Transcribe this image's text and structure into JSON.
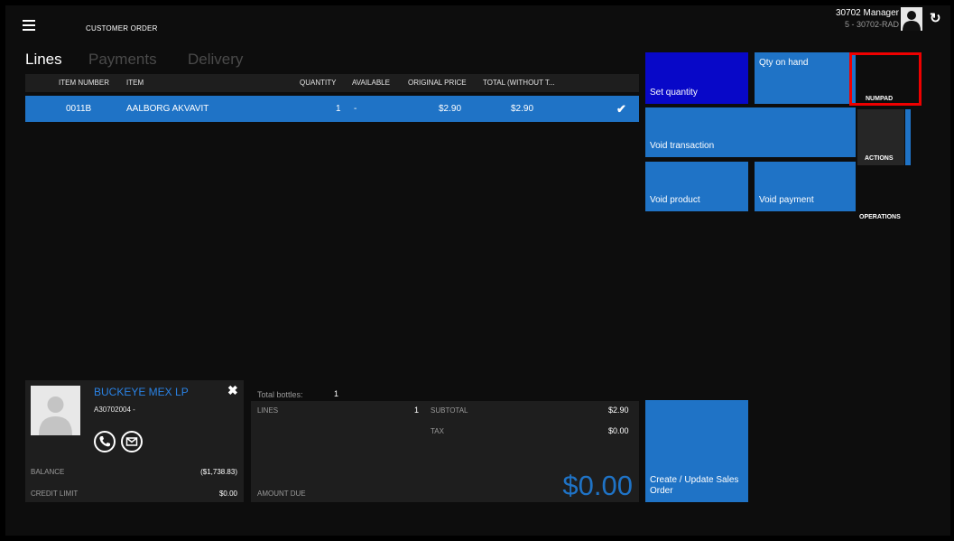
{
  "header": {
    "app_title": "CUSTOMER ORDER",
    "user_name": "30702 Manager",
    "user_store": "5 - 30702-RAD",
    "icons": [
      "hamburger-menu-icon",
      "user-avatar-icon",
      "refresh-icon"
    ]
  },
  "tabs": [
    {
      "label": "Lines",
      "active": true
    },
    {
      "label": "Payments",
      "active": false
    },
    {
      "label": "Delivery",
      "active": false
    }
  ],
  "grid": {
    "columns": [
      "ITEM NUMBER",
      "ITEM",
      "QUANTITY",
      "AVAILABLE",
      "ORIGINAL PRICE",
      "TOTAL (WITHOUT T..."
    ],
    "rows": [
      {
        "item_number": "0011B",
        "item": "AALBORG AKVAVIT",
        "quantity": "1",
        "available": "-",
        "original_price": "$2.90",
        "total": "$2.90",
        "selected": true
      }
    ]
  },
  "customer": {
    "name": "BUCKEYE MEX LP",
    "account": "A30702004  -",
    "balance_label": "BALANCE",
    "balance_value": "($1,738.83)",
    "credit_limit_label": "CREDIT LIMIT",
    "credit_limit_value": "$0.00"
  },
  "totals": {
    "bottles_label": "Total bottles:",
    "bottles_value": "1",
    "lines_label": "LINES",
    "lines_value": "1",
    "subtotal_label": "SUBTOTAL",
    "subtotal_value": "$2.90",
    "tax_label": "TAX",
    "tax_value": "$0.00",
    "amount_due_label": "AMOUNT DUE",
    "amount_due_value": "$0.00"
  },
  "tiles": {
    "set_quantity": "Set quantity",
    "qty_on_hand": "Qty on hand",
    "void_transaction": "Void transaction",
    "void_product": "Void product",
    "void_payment": "Void payment",
    "create_update": "Create / Update Sales Order"
  },
  "side_tabs": {
    "numpad": "NUMPAD",
    "actions": "ACTIONS",
    "operations": "OPERATIONS"
  },
  "colors": {
    "accent": "#1f73c6",
    "selected_tile": "#0808c8",
    "highlight": "#e00000",
    "link": "#2a82e4"
  }
}
